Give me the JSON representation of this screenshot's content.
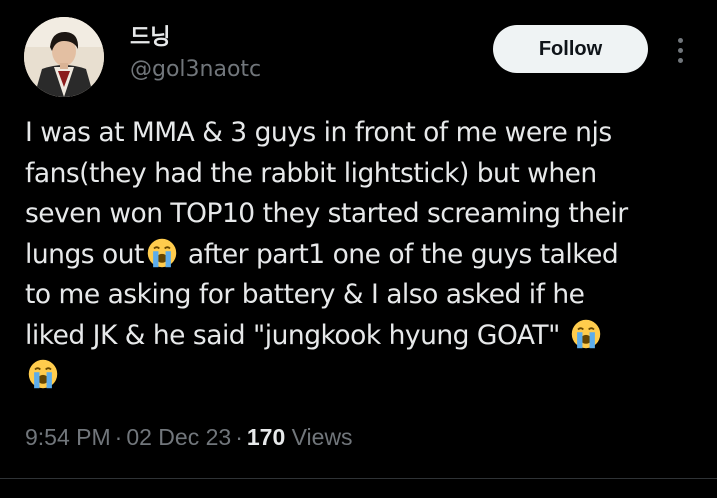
{
  "author": {
    "display_name": "드닝",
    "handle": "@gol3naotc"
  },
  "actions": {
    "follow_label": "Follow",
    "more_icon": "more-vertical-icon"
  },
  "tweet": {
    "lines": [
      "I was at MMA & 3 guys in front of me were njs",
      "fans(they had the rabbit lightstick) but when",
      "seven won TOP10 they started screaming their",
      "lungs out",
      "after part1 one of the guys talked",
      "to me asking for battery & I also asked if he",
      "liked JK & he said \"jungkook hyung GOAT\""
    ],
    "emoji": "loudly-crying-face-icon"
  },
  "meta": {
    "time": "9:54 PM",
    "date": "02 Dec 23",
    "views_count": "170",
    "views_label": "Views",
    "separator": "·"
  },
  "colors": {
    "background": "#000000",
    "text_primary": "#e7e9ea",
    "text_secondary": "#71767b",
    "follow_bg": "#eff3f4"
  }
}
